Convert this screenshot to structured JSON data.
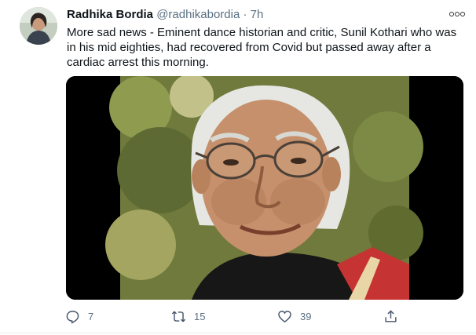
{
  "tweet": {
    "author_name": "Radhika Bordia",
    "author_handle": "@radhikabordia",
    "separator": "·",
    "time": "7h",
    "text": "More sad news - Eminent dance historian and critic, Sunil Kothari who was in his mid eighties, had recovered from Covid but passed away after a cardiac arrest this morning.",
    "actions": {
      "reply_count": "7",
      "retweet_count": "15",
      "like_count": "39"
    }
  },
  "colors": {
    "text": "#0f1419",
    "secondary": "#5b7083",
    "icon": "#44546a"
  },
  "icons": {
    "more": "more-icon",
    "reply": "reply-icon",
    "retweet": "retweet-icon",
    "like": "like-icon",
    "share": "share-icon"
  }
}
